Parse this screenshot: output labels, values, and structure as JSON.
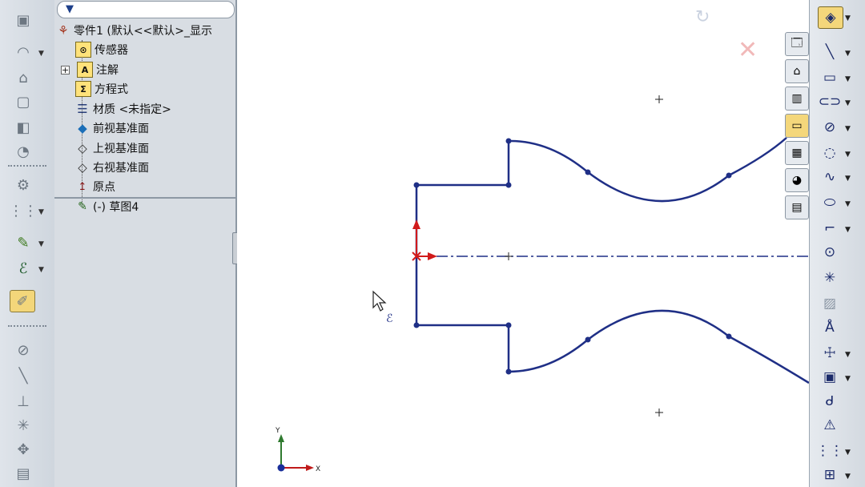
{
  "tree": {
    "root": "零件1  (默认<<默认>_显示",
    "items": [
      {
        "label": "传感器"
      },
      {
        "label": "注解"
      },
      {
        "label": "方程式"
      },
      {
        "label": "材质 <未指定>"
      },
      {
        "label": "前视基准面"
      },
      {
        "label": "上视基准面"
      },
      {
        "label": "右视基准面"
      },
      {
        "label": "原点"
      },
      {
        "label": "(-) 草图4"
      }
    ]
  },
  "icons": {
    "filter": "funnel-icon",
    "sensor": "sensor-icon",
    "annotation": "A",
    "equation": "Σ",
    "material": "material-icon",
    "plane": "plane-icon",
    "origin": "origin-icon",
    "sketch": "sketch-icon"
  },
  "canvas": {
    "axis_y": "Y",
    "axis_x": "X"
  },
  "colors": {
    "sketch_line": "#1f2f86",
    "origin_red": "#d11a1a",
    "toolbar_bg": "#dfe4ea",
    "tree_bg": "#d8dde3"
  }
}
